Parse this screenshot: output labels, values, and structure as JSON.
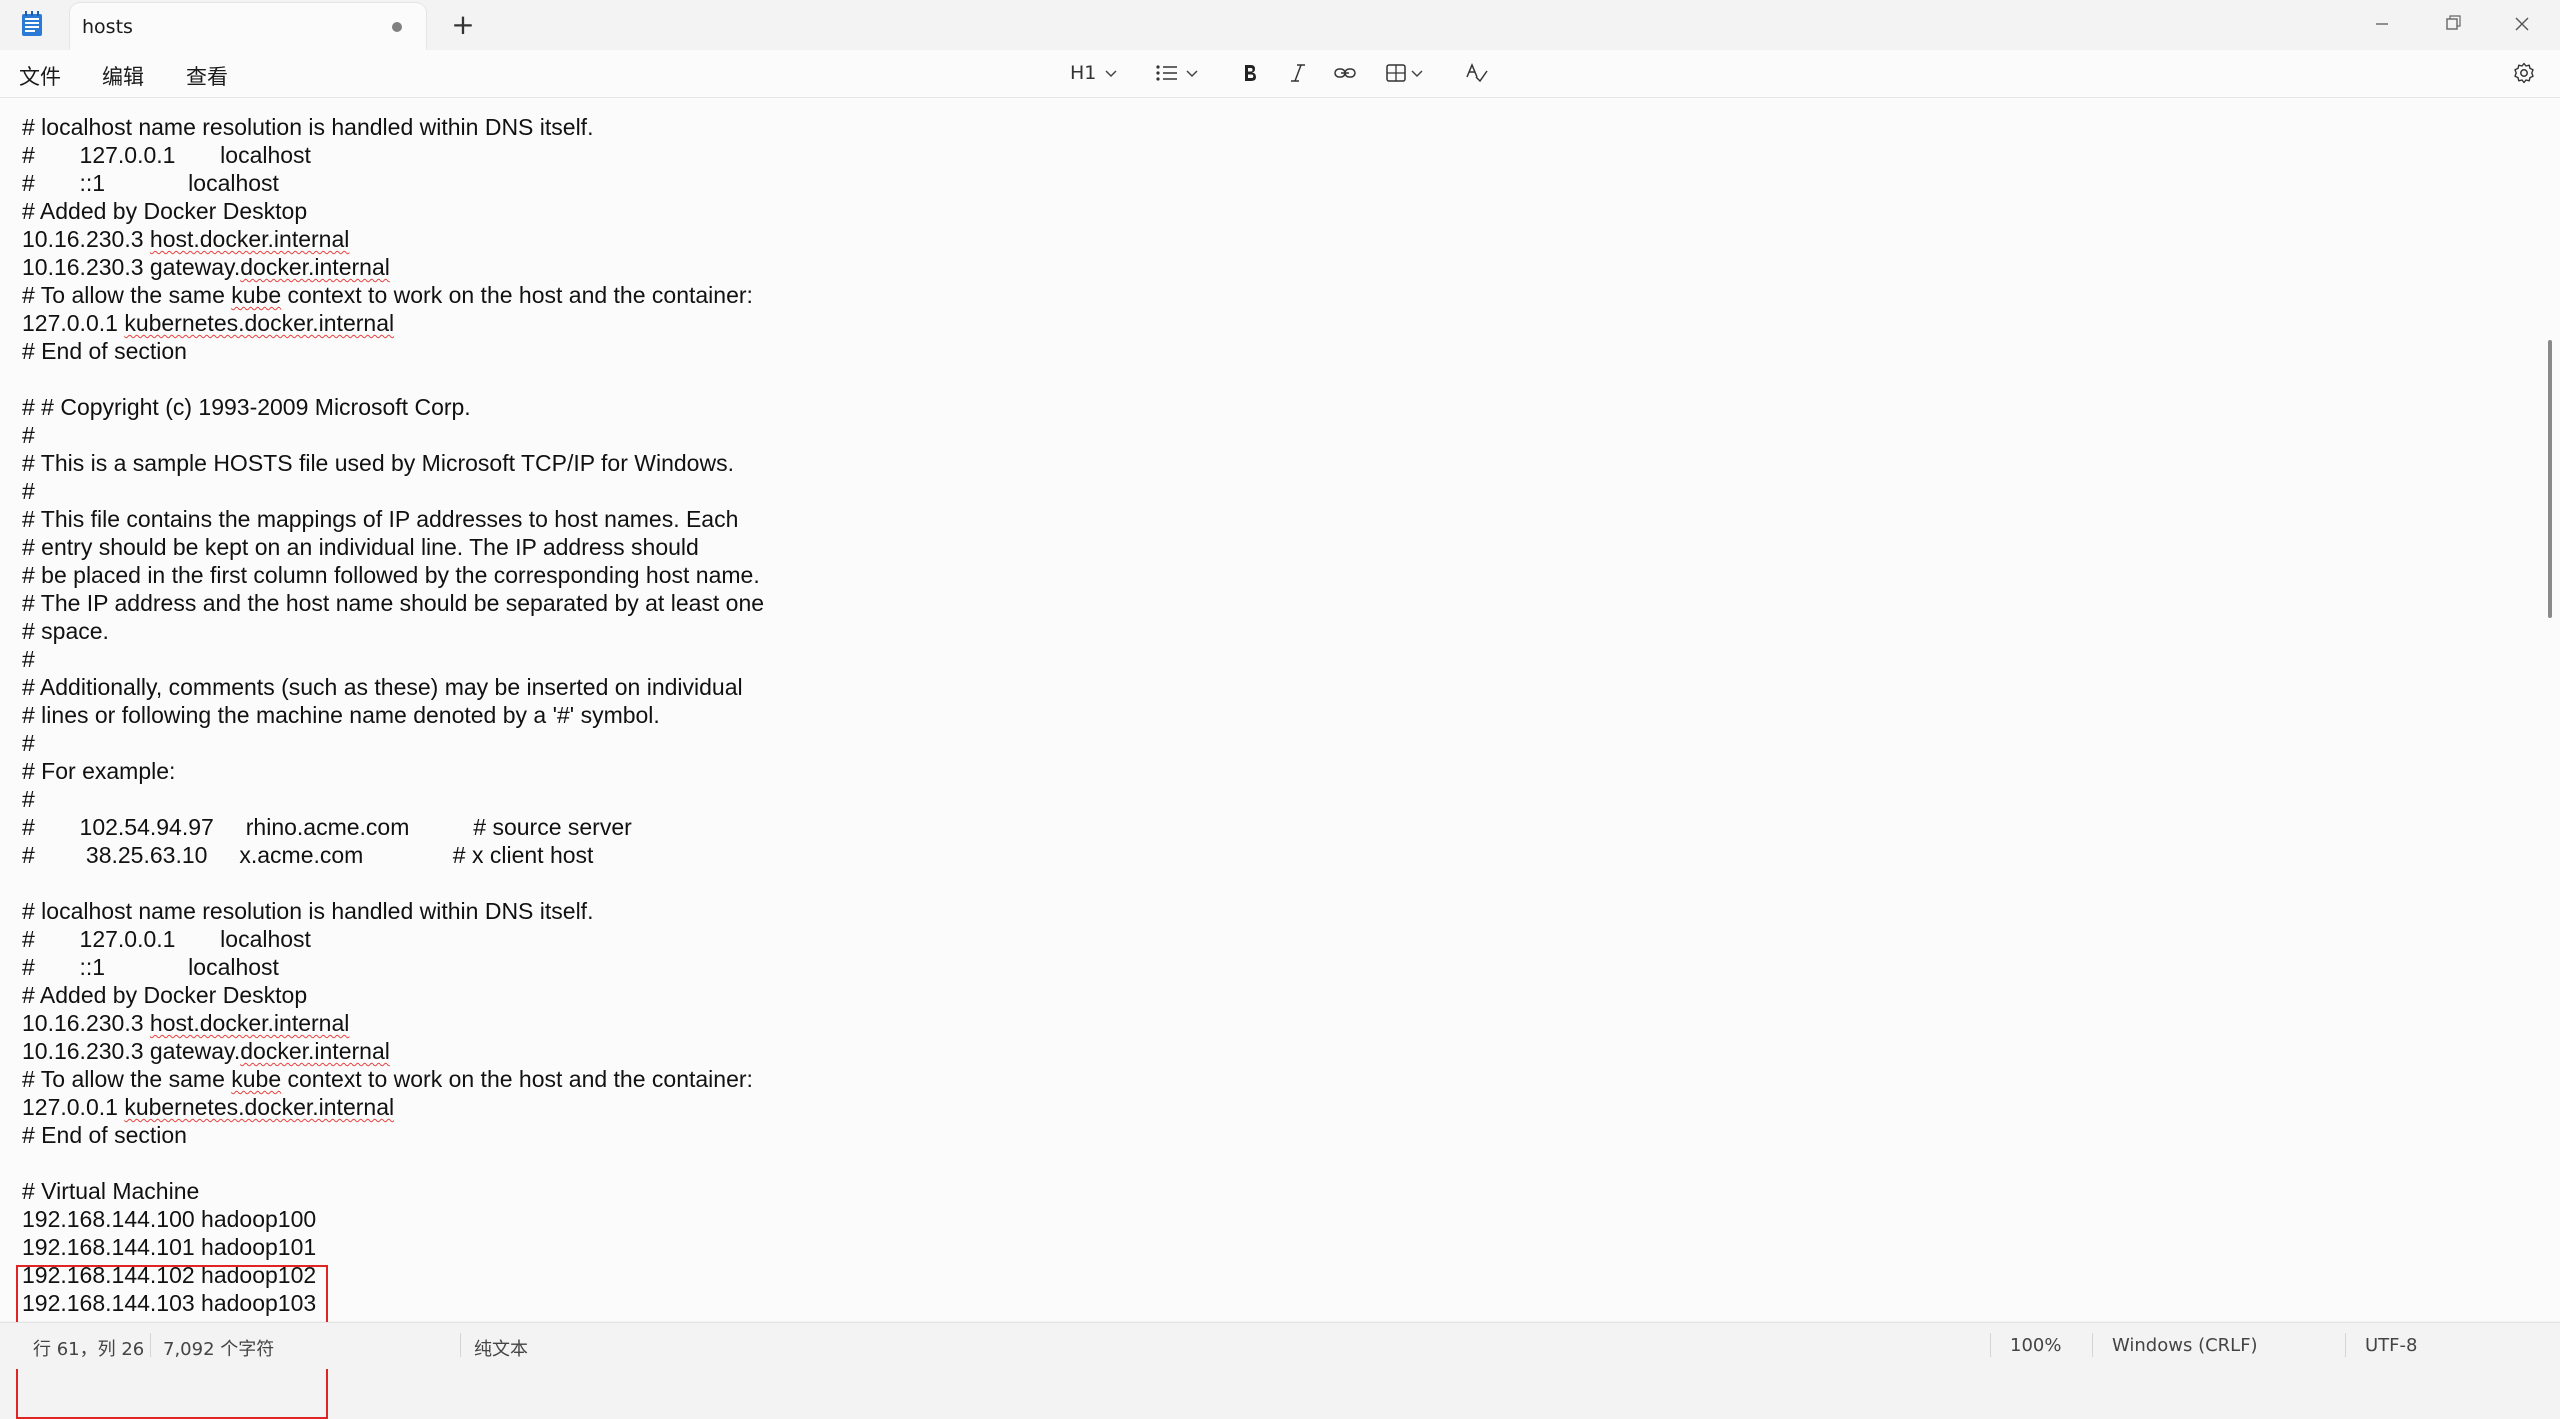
{
  "tab": {
    "title": "hosts"
  },
  "menu": {
    "file": "文件",
    "edit": "编辑",
    "view": "查看"
  },
  "toolbar": {
    "heading_label": "H1"
  },
  "editor": {
    "lines": [
      "# localhost name resolution is handled within DNS itself.",
      "#       127.0.0.1       localhost",
      "#       ::1             localhost",
      "# Added by Docker Desktop",
      "10.16.230.3 host.docker.internal",
      "10.16.230.3 gateway.docker.internal",
      "# To allow the same kube context to work on the host and the container:",
      "127.0.0.1 kubernetes.docker.internal",
      "# End of section",
      "",
      "# # Copyright (c) 1993-2009 Microsoft Corp.",
      "#",
      "# This is a sample HOSTS file used by Microsoft TCP/IP for Windows.",
      "#",
      "# This file contains the mappings of IP addresses to host names. Each",
      "# entry should be kept on an individual line. The IP address should",
      "# be placed in the first column followed by the corresponding host name.",
      "# The IP address and the host name should be separated by at least one",
      "# space.",
      "#",
      "# Additionally, comments (such as these) may be inserted on individual",
      "# lines or following the machine name denoted by a '#' symbol.",
      "#",
      "# For example:",
      "#",
      "#       102.54.94.97     rhino.acme.com          # source server",
      "#        38.25.63.10     x.acme.com              # x client host",
      "",
      "# localhost name resolution is handled within DNS itself.",
      "#       127.0.0.1       localhost",
      "#       ::1             localhost",
      "# Added by Docker Desktop",
      "10.16.230.3 host.docker.internal",
      "10.16.230.3 gateway.docker.internal",
      "# To allow the same kube context to work on the host and the container:",
      "127.0.0.1 kubernetes.docker.internal",
      "# End of section",
      "",
      "# Virtual Machine",
      "192.168.144.100 hadoop100",
      "192.168.144.101 hadoop101",
      "192.168.144.102 hadoop102",
      "192.168.144.103 hadoop103"
    ],
    "squiggles": [
      "host.docker.internal",
      "docker.internal",
      "kube",
      "kubernetes.docker.internal"
    ]
  },
  "status": {
    "position": "行 61，列 26",
    "char_count": "7,092 个字符",
    "format": "纯文本",
    "zoom": "100%",
    "line_ending": "Windows (CRLF)",
    "encoding": "UTF-8"
  },
  "colors": {
    "accent_box": "#e02424",
    "squiggle": "#e8413e"
  }
}
